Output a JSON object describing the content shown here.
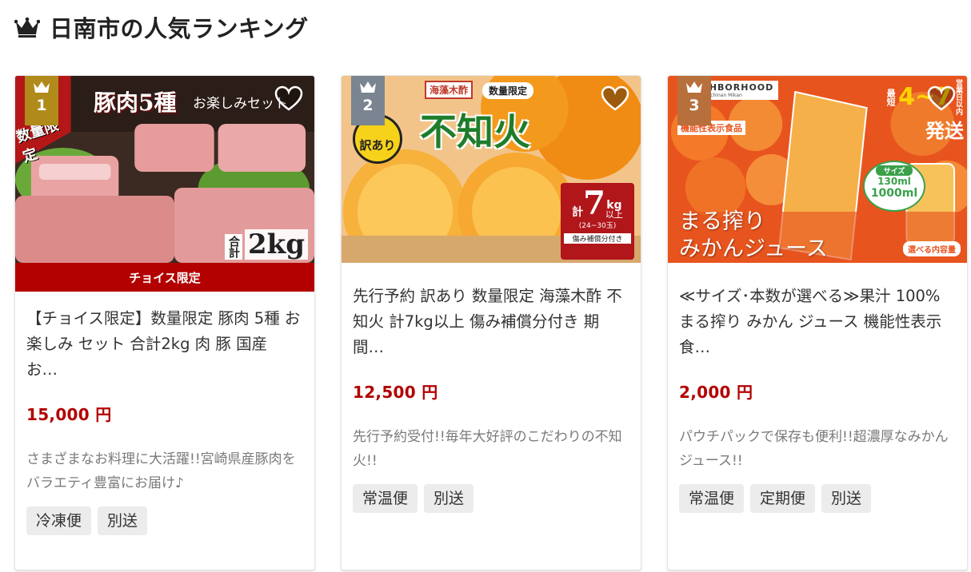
{
  "heading": {
    "title": "日南市の人気ランキング",
    "icon": "crown-icon"
  },
  "colors": {
    "accent_red": "#b30000",
    "rank_gold": "#b08a1a",
    "rank_silver": "#7a8591",
    "rank_bronze": "#b7703c"
  },
  "cards": [
    {
      "rank": "1",
      "banner": "チョイス限定",
      "title": "【チョイス限定】数量限定 豚肉 5種 お楽しみ セット 合計2kg 肉 豚 国産 お…",
      "price": "15,000 円",
      "desc": "さまざまなお料理に大活躍!!宮崎県産豚肉をバラエティ豊富にお届け♪",
      "tags": [
        "冷凍便",
        "別送"
      ],
      "image": {
        "badge": "数量限定",
        "headline": "豚肉5種",
        "sub": "お楽しみセット",
        "total_prefix": "合計",
        "total": "2kg"
      }
    },
    {
      "rank": "2",
      "title": "先行予約 訳あり 数量限定 海藻木酢 不知火 計7kg以上 傷み補償分付き 期間…",
      "price": "12,500 円",
      "desc": "先行予約受付!!毎年大好評のこだわりの不知火!!",
      "tags": [
        "常温便",
        "別送"
      ],
      "image": {
        "tag1": "海藻木酢",
        "tag2": "数量限定",
        "stamp": "訳あり",
        "headline": "不知火",
        "weight_prefix": "計",
        "weight": "7",
        "weight_unit": "kg",
        "weight_suffix": "以上",
        "range": "(24~30玉)",
        "note": "傷み補償分付き"
      }
    },
    {
      "rank": "3",
      "title": "≪サイズ･本数が選べる≫果汁 100% まる搾り みかん ジュース 機能性表示食…",
      "price": "2,000 円",
      "desc": "パウチパックで保存も便利!!超濃厚なみかんジュース!!",
      "tags": [
        "常温便",
        "定期便",
        "別送"
      ],
      "image": {
        "brand": "NEIGHBORHOOD",
        "brand_sub": "Miyazaki_Nichinan Mikan",
        "label": "機能性表示食品",
        "ship_prefix": "最短",
        "ship_days": "4~7",
        "ship_suffix": "営業日以内",
        "ship": "発送",
        "size_label": "サイズ",
        "size_small": "130ml",
        "size_large": "1000ml",
        "headline1": "まる搾り",
        "headline2": "みかんジュース",
        "choose": "選べる内容量"
      }
    }
  ]
}
